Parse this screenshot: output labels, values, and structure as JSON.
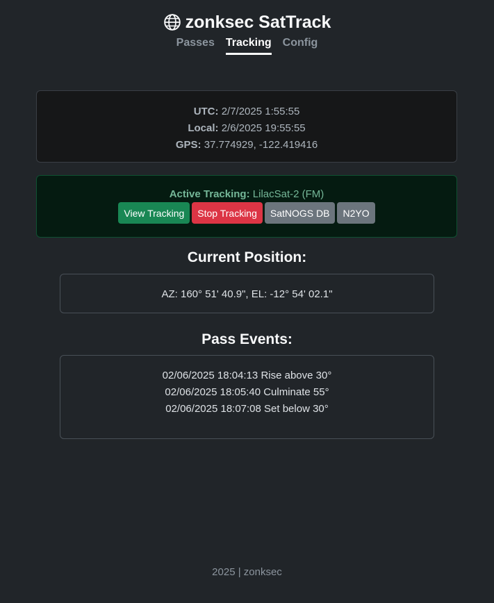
{
  "header": {
    "title": "zonksec SatTrack",
    "icon": "globe-icon"
  },
  "nav": {
    "tabs": [
      {
        "label": "Passes",
        "active": false
      },
      {
        "label": "Tracking",
        "active": true
      },
      {
        "label": "Config",
        "active": false
      }
    ]
  },
  "time": {
    "utc_label": "UTC:",
    "utc_value": "2/7/2025 1:55:55",
    "local_label": "Local:",
    "local_value": "2/6/2025 19:55:55",
    "gps_label": "GPS:",
    "gps_value": "37.774929, -122.419416"
  },
  "tracking": {
    "label": "Active Tracking:",
    "satellite": "LilacSat-2 (FM)",
    "buttons": {
      "view": "View Tracking",
      "stop": "Stop Tracking",
      "satnogs": "SatNOGS DB",
      "n2yo": "N2YO"
    }
  },
  "position": {
    "heading": "Current Position:",
    "value": "AZ: 160° 51' 40.9\", EL: -12° 54' 02.1\""
  },
  "events": {
    "heading": "Pass Events:",
    "items": [
      "02/06/2025 18:04:13 Rise above 30°",
      "02/06/2025 18:05:40 Culminate 55°",
      "02/06/2025 18:07:08 Set below 30°"
    ]
  },
  "footer": {
    "text": "2025 | zonksec"
  },
  "colors": {
    "background": "#212529",
    "success": "#198754",
    "danger": "#dc3545",
    "secondary": "#6c757d",
    "tracking_text": "#75b798"
  }
}
